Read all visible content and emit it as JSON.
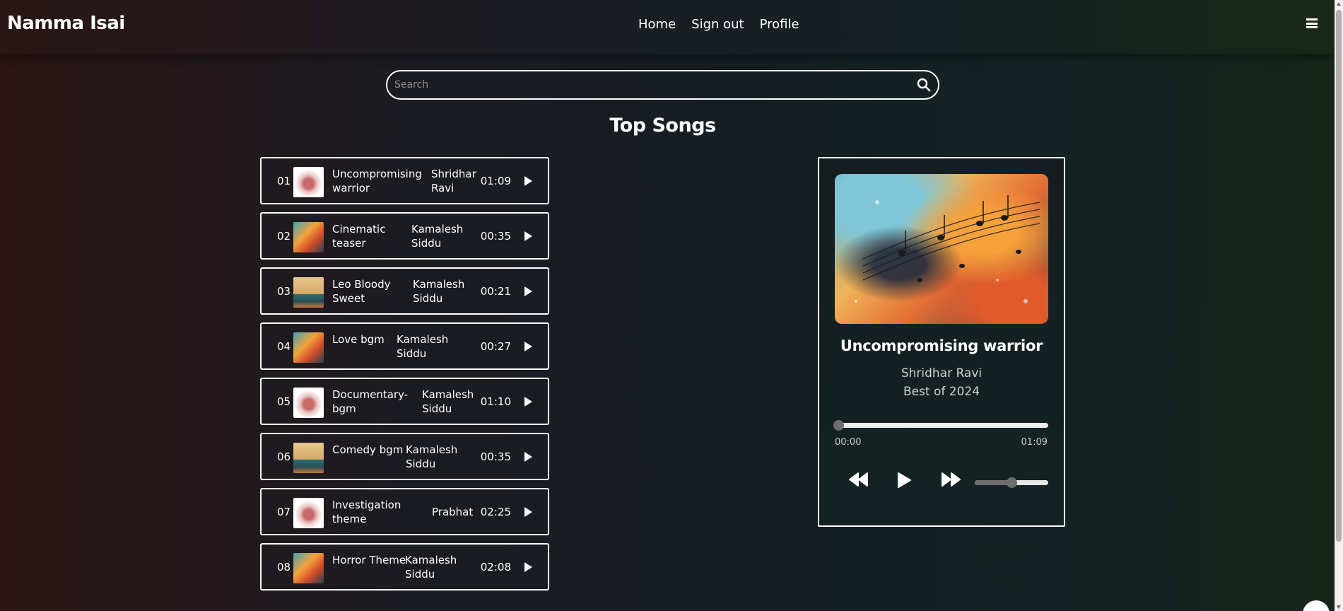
{
  "app": {
    "brand": "Namma Isai"
  },
  "nav": {
    "links": [
      "Home",
      "Sign out",
      "Profile"
    ]
  },
  "search": {
    "placeholder": "Search",
    "value": ""
  },
  "section_title": "Top Songs",
  "songs": [
    {
      "num": "01",
      "title": "Uncompromising warrior",
      "artist": "Shridhar Ravi",
      "duration": "01:09",
      "thumb": "t1"
    },
    {
      "num": "02",
      "title": "Cinematic teaser",
      "artist": "Kamalesh Siddu",
      "duration": "00:35",
      "thumb": "t2"
    },
    {
      "num": "03",
      "title": "Leo Bloody Sweet",
      "artist": "Kamalesh Siddu",
      "duration": "00:21",
      "thumb": "t3"
    },
    {
      "num": "04",
      "title": "Love bgm",
      "artist": "Kamalesh Siddu",
      "duration": "00:27",
      "thumb": "t2"
    },
    {
      "num": "05",
      "title": "Documentary-bgm",
      "artist": "Kamalesh Siddu",
      "duration": "01:10",
      "thumb": "t1"
    },
    {
      "num": "06",
      "title": "Comedy bgm",
      "artist": "Kamalesh Siddu",
      "duration": "00:35",
      "thumb": "t3"
    },
    {
      "num": "07",
      "title": "Investigation theme",
      "artist": "Prabhat",
      "duration": "02:25",
      "thumb": "t1"
    },
    {
      "num": "08",
      "title": "Horror Theme",
      "artist": "Kamalesh Siddu",
      "duration": "02:08",
      "thumb": "t2"
    }
  ],
  "player": {
    "title": "Uncompromising warrior",
    "artist": "Shridhar Ravi",
    "album": "Best of 2024",
    "current_time": "00:00",
    "total_time": "01:09",
    "progress_fraction": 0,
    "volume_fraction": 0.5
  },
  "colors": {
    "background_left": "#2a1414",
    "background_right": "#17261a",
    "accent": "#ffffff"
  }
}
